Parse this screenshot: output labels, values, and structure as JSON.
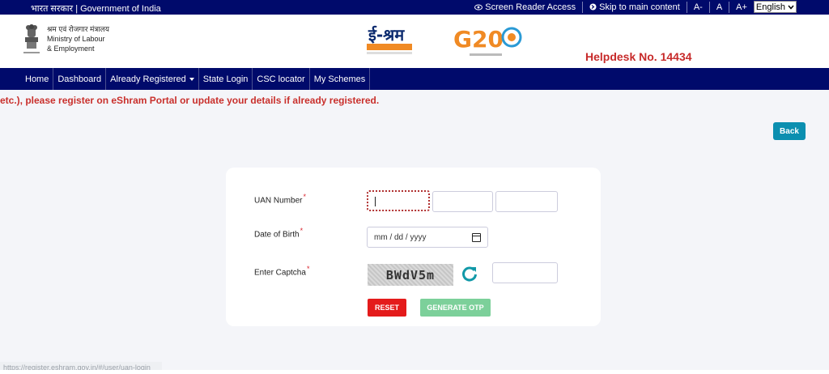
{
  "gov_bar": {
    "left_text": "भारत सरकार | Government of India",
    "screen_reader": "Screen Reader Access",
    "skip_main": "Skip to main content",
    "font_decrease": "A-",
    "font_normal": "A",
    "font_increase": "A+",
    "language": "English"
  },
  "header": {
    "ministry_hindi": "श्रम एवं रोजगार मंत्रालय",
    "ministry_line1": "Ministry of Labour",
    "ministry_line2": "& Employment",
    "eshram_logo_text": "ई-श्रम",
    "g20_logo_text": "G20",
    "helpdesk": "Helpdesk No. 14434"
  },
  "nav": {
    "items": [
      "Home",
      "Dashboard",
      "Already Registered",
      "State Login",
      "CSC locator",
      "My Schemes"
    ]
  },
  "notice": "etc.), please register on eShram Portal or update your details if already registered.",
  "back_label": "Back",
  "form": {
    "uan_label": "UAN Number",
    "dob_label": "Date of Birth",
    "dob_placeholder": "mm / dd / yyyy",
    "captcha_label": "Enter Captcha",
    "captcha_text": "BWdV5m",
    "required_mark": "*",
    "reset_label": "RESET",
    "otp_label": "GENERATE OTP"
  },
  "status_url": "https://register.eshram.gov.in/#/user/uan-login",
  "colors": {
    "navy": "#000a6b",
    "helpdesk_red": "#c72a2a",
    "back_blue": "#0b8fb0",
    "reset_red": "#e41b1b",
    "otp_green": "#7cd09a"
  }
}
